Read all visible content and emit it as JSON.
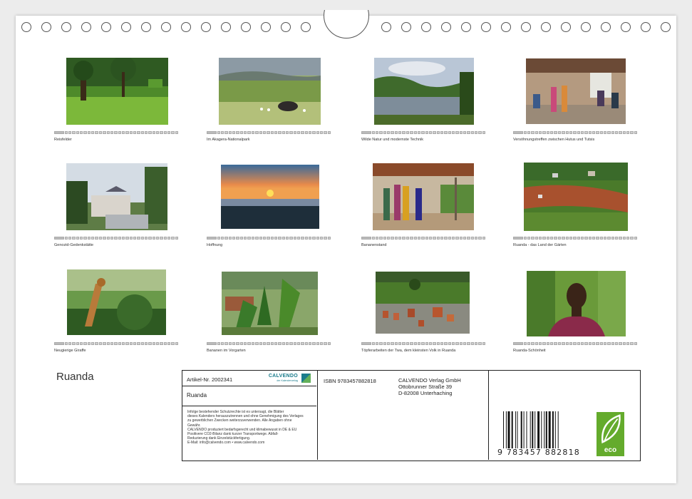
{
  "calendar": {
    "title": "Ruanda"
  },
  "thumbnails": [
    {
      "caption": "Reisfelder"
    },
    {
      "caption": "Im Akagera-Nationalpark"
    },
    {
      "caption": "Wilde Natur und modernste Technik"
    },
    {
      "caption": "Versöhnungstreffen zwischen Hutus und Tutsis"
    },
    {
      "caption": "Genozid-Gedenkstätte"
    },
    {
      "caption": "Hoffnung"
    },
    {
      "caption": "Bananenstand"
    },
    {
      "caption": "Ruanda - das Land der Gärten"
    },
    {
      "caption": "Neugierige Giraffe"
    },
    {
      "caption": "Bananen im Vorgarten"
    },
    {
      "caption": "Töpferarbeiten der Twa, dem kleinsten Volk in Ruanda"
    },
    {
      "caption": "Ruanda-Schönheit"
    }
  ],
  "info": {
    "article": "Artikel-Nr. 2002341",
    "brand": "CALVENDO",
    "brand_tagline": "der Kalenderverlag",
    "subtitle": "Ruanda",
    "legal": [
      "Infolge bestehender Schutzrechte ist es untersagt, die Blätter",
      "dieses Kalenders herauszutrennen und ohne Genehmigung des Verlages",
      "zu gewerblichen Zwecken weiterzuverwenden. Alle Angaben ohne",
      "Gewähr.",
      "CALVENDO produziert bedarfsgerecht und klimabewusst in DE & EU",
      "Positivere CO2-Bilanz dank kurzer Transportwege. Abfall-",
      "Reduzierung dank Einzelstückfertigung.",
      "E-Mail: info@calvendo.com • www.calvendo.com"
    ],
    "isbn": "ISBN 9783457882818",
    "publisher_lines": [
      "CALVENDO Verlag GmbH",
      "Ottobrunner Straße 39",
      "D-82008 Unterhaching"
    ],
    "barcode_number": "9  783457  882818",
    "eco_label": "eco"
  },
  "colors": {
    "brand": "#1b7c8c",
    "eco": "#64ab2c"
  }
}
